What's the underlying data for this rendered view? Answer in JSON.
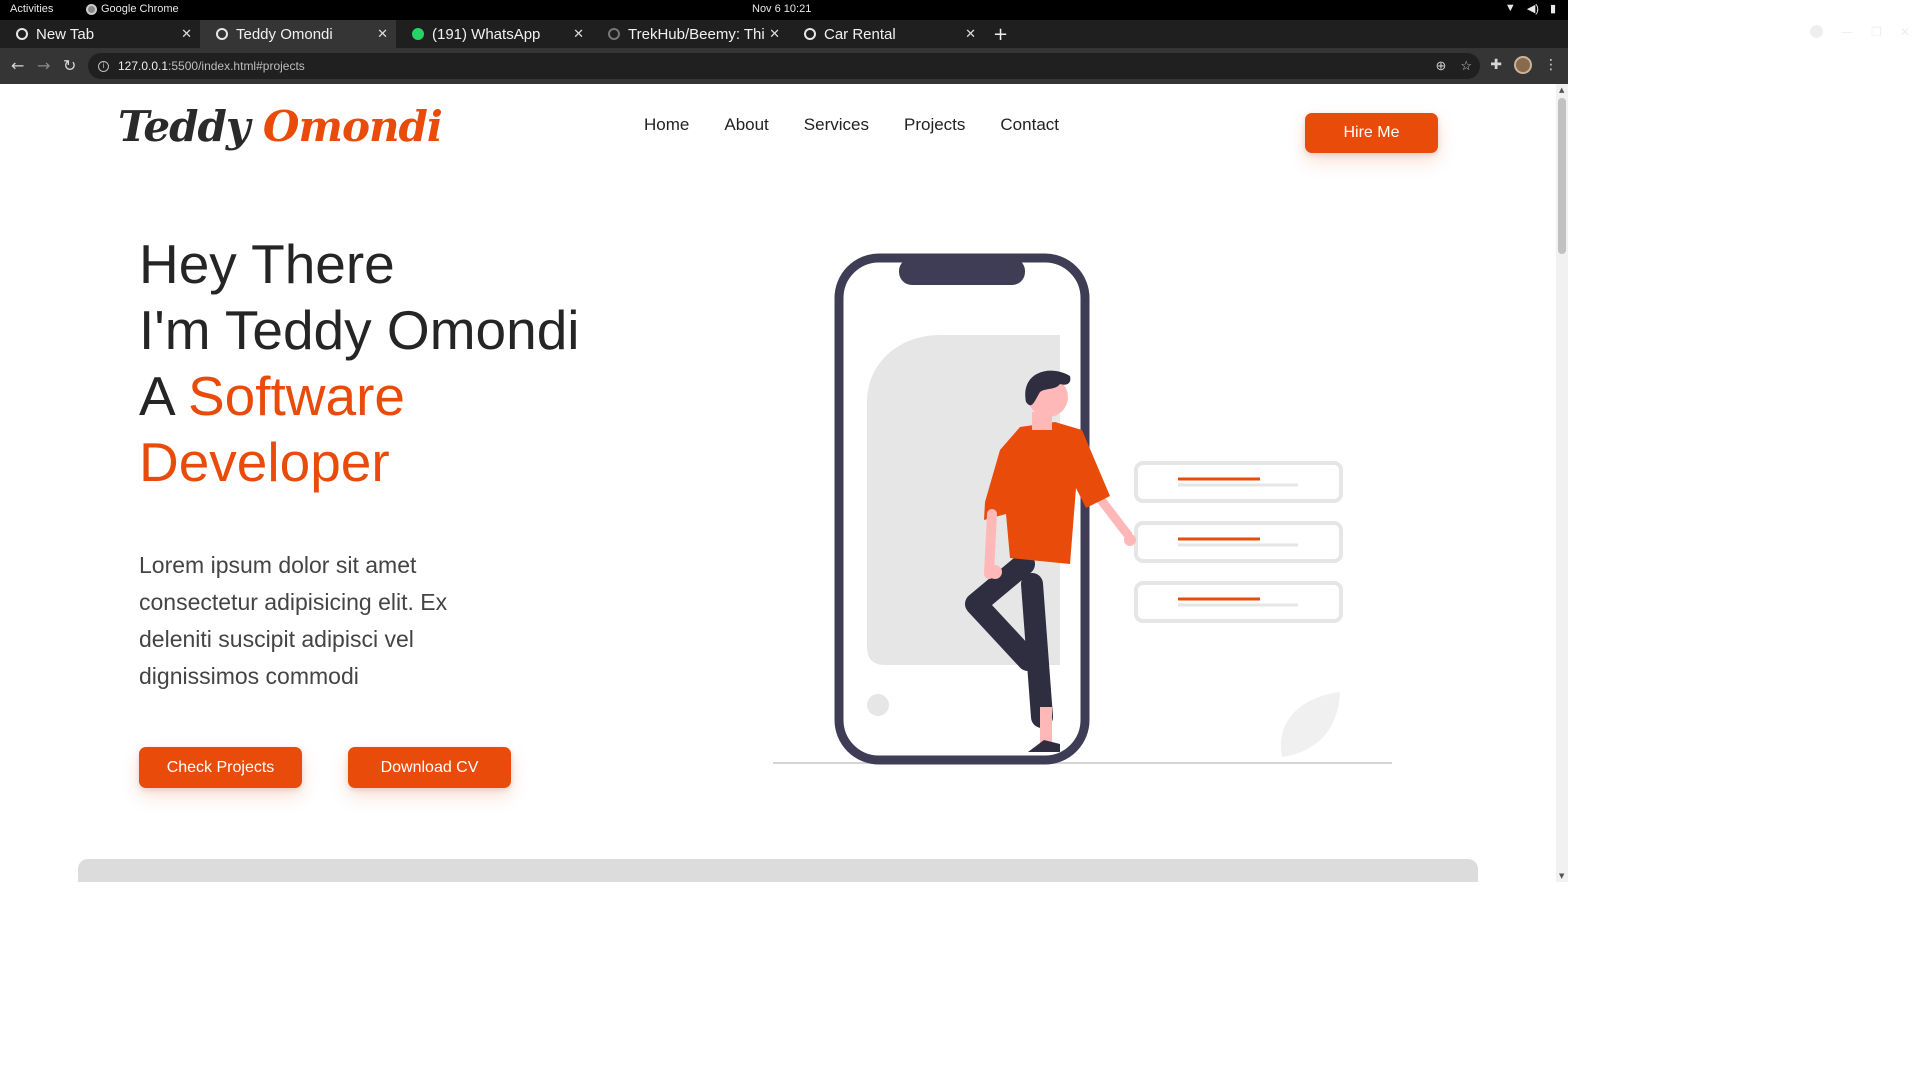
{
  "system_bar": {
    "activities": "Activities",
    "app_name": "Google Chrome",
    "clock": "Nov 6  10:21"
  },
  "tabs": [
    {
      "label": "New Tab",
      "active": false
    },
    {
      "label": "Teddy Omondi",
      "active": true
    },
    {
      "label": "(191) WhatsApp",
      "active": false
    },
    {
      "label": "TrekHub/Beemy: Thi",
      "active": false
    },
    {
      "label": "Car Rental",
      "active": false
    }
  ],
  "address_bar": {
    "host": "127.0.0.1",
    "path": ":5500/index.html#projects"
  },
  "site": {
    "logo_first": "Teddy",
    "logo_last": "Omondi",
    "nav": [
      "Home",
      "About",
      "Services",
      "Projects",
      "Contact"
    ],
    "hire_label": "Hire Me",
    "hero": {
      "line1": "Hey There",
      "line2": "I'm Teddy Omondi",
      "line3_prefix": "A ",
      "line3_accent": "Software",
      "line4_accent": "Developer"
    },
    "paragraph": "Lorem ipsum dolor sit amet consectetur adipisicing elit. Ex deleniti suscipit adipisci vel dignissimos commodi",
    "check_projects_label": "Check Projects",
    "download_cv_label": "Download CV"
  },
  "colors": {
    "accent": "#e84b0a",
    "text_dark": "#252525",
    "phone_frame": "#3f3d56"
  },
  "icons": {
    "back": "arrow-left-icon",
    "forward": "arrow-right-icon",
    "reload": "reload-icon",
    "site_info": "info-icon",
    "zoom": "zoom-icon",
    "bookmark": "star-icon",
    "extensions": "puzzle-icon",
    "menu": "kebab-menu-icon"
  }
}
